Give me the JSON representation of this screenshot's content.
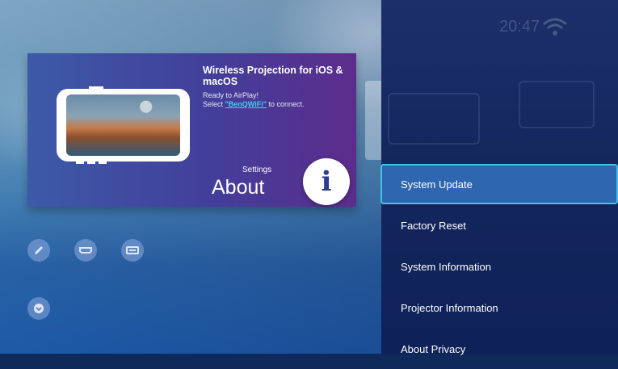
{
  "status_bar": {
    "time": "20:47"
  },
  "card": {
    "title": "Wireless Projection for iOS & macOS",
    "line1": "Ready to AirPlay!",
    "line2_prefix": "Select ",
    "line2_link": "\"BenQWiFi\"",
    "line2_suffix": " to connect.",
    "settings_label": "Settings",
    "about_label": "About",
    "info_icon": "i"
  },
  "menu": {
    "items": [
      {
        "label": "System Update",
        "selected": true
      },
      {
        "label": "Factory Reset"
      },
      {
        "label": "System Information"
      },
      {
        "label": "Projector Information"
      },
      {
        "label": "About Privacy"
      }
    ]
  },
  "side_icons": [
    "pencil-icon",
    "hdmi-icon",
    "usb-icon",
    "chevron-down-icon"
  ],
  "colors": {
    "accent": "#3fc4e8",
    "selected_bg": "#2f66b0",
    "panel_bg": "#14275d",
    "link": "#41d0f0"
  }
}
